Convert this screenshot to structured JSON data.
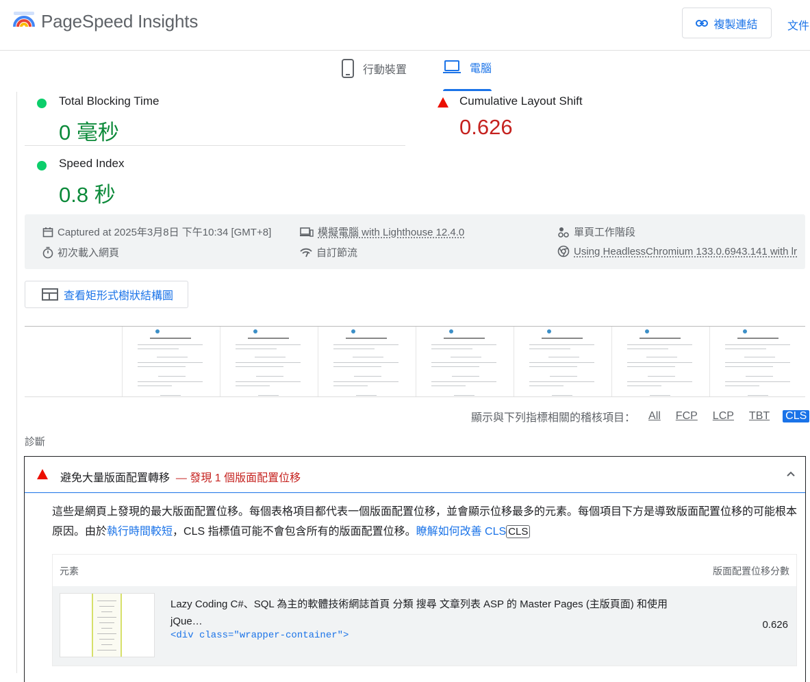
{
  "header": {
    "brand": "PageSpeed Insights",
    "copy_link": "複製連結",
    "docs": "文件"
  },
  "tabs": [
    {
      "label": "行動裝置",
      "icon": "phone-icon",
      "active": false
    },
    {
      "label": "電腦",
      "icon": "laptop-icon",
      "active": true
    }
  ],
  "metrics": {
    "tbt": {
      "label": "Total Blocking Time",
      "value": "0 毫秒",
      "status": "pass",
      "color": "#0c8a3a"
    },
    "cls": {
      "label": "Cumulative Layout Shift",
      "value": "0.626",
      "status": "fail",
      "color": "#c5221f"
    },
    "si": {
      "label": "Speed Index",
      "value": "0.8 秒",
      "status": "pass",
      "color": "#0c8a3a"
    }
  },
  "runinfo": {
    "captured": "Captured at 2025年3月8日 下午10:34 [GMT+8]",
    "device": "模擬電腦 with Lighthouse 12.4.0",
    "session": "單頁工作階段",
    "load": "初次載入網頁",
    "throttling": "自訂節流",
    "browser": "Using HeadlessChromium 133.0.6943.141 with lr"
  },
  "treemap_button": "查看矩形式樹狀結構圖",
  "filters": {
    "label": "顯示與下列指標相關的稽核項目：",
    "options": [
      "All",
      "FCP",
      "LCP",
      "TBT",
      "CLS"
    ],
    "active": "CLS"
  },
  "diagnostics_heading": "診斷",
  "audit": {
    "title": "避免大量版面配置轉移",
    "warning": "— 發現 1 個版面配置位移",
    "desc_part1": "這些是網頁上發現的最大版面配置位移。每個表格項目都代表一個版面配置位移，並會顯示位移最多的元素。每個項目下方是導致版面配置位移的可能根本原因。由於",
    "desc_link1": "執行時間較短",
    "desc_part2": "，CLS 指標值可能不會包含所有的版面配置位移。",
    "desc_link2": "瞭解如何改善 CLS",
    "desc_badge": "CLS",
    "table": {
      "col_element": "元素",
      "col_score": "版面配置位移分數",
      "row": {
        "label": "Lazy Coding C#、SQL 為主的軟體技術網誌首頁 分類 搜尋 文章列表 ASP 的 Master Pages (主版頁面) 和使用 jQue…",
        "code": "<div class=\"wrapper-container\">",
        "score": "0.626"
      }
    }
  }
}
